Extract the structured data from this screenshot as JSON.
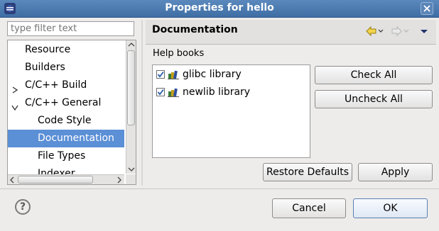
{
  "window": {
    "title": "Properties for hello",
    "colors": {
      "titlebar": "#4a79b0",
      "selection": "#5b8fd6"
    }
  },
  "filter": {
    "placeholder": "type filter text",
    "value": ""
  },
  "tree": {
    "items": [
      {
        "label": "Resource",
        "icon": "none",
        "selected": false
      },
      {
        "label": "Builders",
        "icon": "none",
        "selected": false
      },
      {
        "label": "C/C++ Build",
        "icon": "collapsed-twisty-icon",
        "selected": false
      },
      {
        "label": "C/C++ General",
        "icon": "expanded-twisty-icon",
        "selected": false
      },
      {
        "label": "Code Style",
        "icon": "none",
        "selected": false
      },
      {
        "label": "Documentation",
        "icon": "none",
        "selected": true
      },
      {
        "label": "File Types",
        "icon": "none",
        "selected": false
      },
      {
        "label": "Indexer",
        "icon": "none",
        "selected": false
      }
    ]
  },
  "page": {
    "title": "Documentation",
    "nav": {
      "back_icon": "back-arrow-icon",
      "forward_icon": "forward-arrow-icon",
      "menu_icon": "view-menu-icon"
    },
    "section_label": "Help books",
    "books": [
      {
        "label": "glibc library",
        "checked": true,
        "icon": "help-book-icon"
      },
      {
        "label": "newlib library",
        "checked": true,
        "icon": "help-book-icon"
      }
    ],
    "check_all_label": "Check All",
    "uncheck_all_label": "Uncheck All",
    "restore_defaults_label": "Restore Defaults",
    "apply_label": "Apply"
  },
  "footer": {
    "help_icon": "help-icon",
    "cancel_label": "Cancel",
    "ok_label": "OK"
  }
}
